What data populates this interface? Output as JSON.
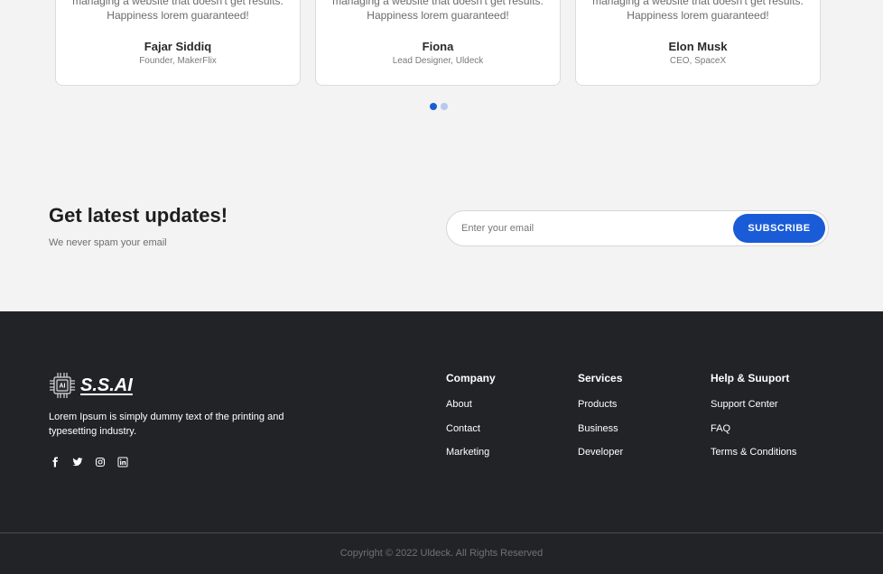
{
  "testimonials": [
    {
      "quote_line1": "managing a website that doesn't get results.",
      "quote_line2": "Happiness lorem guaranteed!",
      "name": "Fajar Siddiq",
      "role": "Founder, MakerFlix"
    },
    {
      "quote_line1": "managing a website that doesn't get results.",
      "quote_line2": "Happiness lorem guaranteed!",
      "name": "Fiona",
      "role": "Lead Designer, Uldeck"
    },
    {
      "quote_line1": "managing a website that doesn't get results.",
      "quote_line2": "Happiness lorem guaranteed!",
      "name": "Elon Musk",
      "role": "CEO, SpaceX"
    }
  ],
  "carousel": {
    "active_index": 0,
    "count": 2
  },
  "newsletter": {
    "title": "Get latest updates!",
    "subtitle": "We never spam your email",
    "email_placeholder": "Enter your email",
    "subscribe_label": "SUBSCRIBE"
  },
  "footer": {
    "logo_chip_text": "AI",
    "logo_text": "S.S.AI",
    "description": "Lorem Ipsum is simply dummy text of the printing and typesetting industry.",
    "socials": [
      "facebook-icon",
      "twitter-icon",
      "instagram-icon",
      "linkedin-icon"
    ],
    "columns": {
      "company": {
        "title": "Company",
        "links": [
          "About",
          "Contact",
          "Marketing"
        ]
      },
      "services": {
        "title": "Services",
        "links": [
          "Products",
          "Business",
          "Developer"
        ]
      },
      "help": {
        "title": "Help & Suuport",
        "links": [
          "Support Center",
          "FAQ",
          "Terms & Conditions"
        ]
      }
    },
    "copyright": "Copyright © 2022 Uldeck. All Rights Reserved"
  },
  "colors": {
    "accent": "#1a5bd8",
    "page_bg": "#f3f3f3",
    "footer_bg": "#212327"
  }
}
